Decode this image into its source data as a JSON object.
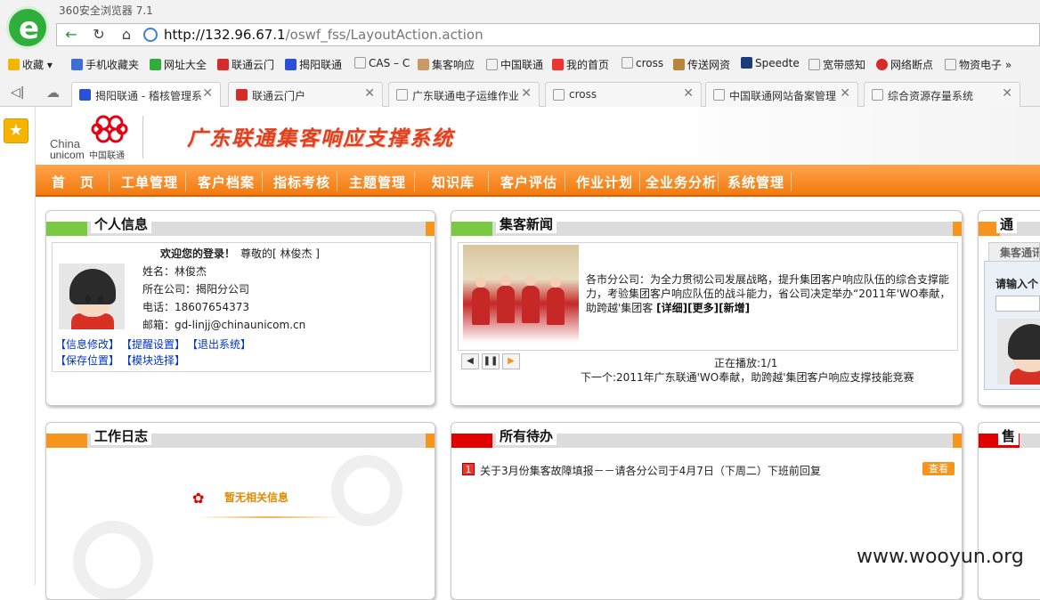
{
  "browser": {
    "window_title": "360安全浏览器 7.1",
    "url_host": "http://132.96.67.1",
    "url_path": "/oswf_fss/LayoutAction.action",
    "bookmarks": [
      "收藏",
      "手机收藏夹",
      "网址大全",
      "联通云门",
      "揭阳联通",
      "CAS – C",
      "集客响应",
      "中国联通",
      "我的首页",
      "cross",
      "传送网资",
      "Speedte",
      "宽带感知",
      "网络断点",
      "物资电子"
    ],
    "tabs": [
      "揭阳联通 - 稽核管理系",
      "联通云门户",
      "广东联通电子运维作业",
      "cross",
      "中国联通网站备案管理",
      "综合资源存量系统"
    ]
  },
  "header": {
    "logo_text": "China unicom中国联通",
    "system_title": "广东联通集客响应支撑系统"
  },
  "menu": [
    "首　页",
    "工单管理",
    "客户档案",
    "指标考核",
    "主题管理",
    "知识库",
    "客户评估",
    "作业计划",
    "全业务分析",
    "系统管理"
  ],
  "personal": {
    "title": "个人信息",
    "welcome": "欢迎您的登录！",
    "greeting": "尊敬的[ 林俊杰 ]",
    "name": "姓名：林俊杰",
    "company": "所在公司：揭阳分公司",
    "phone": "电话：18607654373",
    "email": "邮箱：gd-linjj@chinaunicom.cn",
    "links": [
      "【信息修改】",
      "【提醒设置】",
      "【退出系统】",
      "【保存位置】",
      "【模块选择】"
    ]
  },
  "news": {
    "title": "集客新闻",
    "body": "各市分公司：为全力贯彻公司发展战略，提升集团客户响应队伍的综合支撑能力，考验集团客户响应队伍的战斗能力，省公司决定举办“2011年'WO奉献，助跨越'集团客",
    "links": [
      "[详细]",
      "[更多]",
      "[新增]"
    ],
    "playing": "正在播放:1/1",
    "next": "下一个:2011年广东联通'WO奉献，助跨越'集团客户响应支撑技能竞赛"
  },
  "notice": {
    "title": "通",
    "tab": "集客通讯",
    "input_label": "请输入个"
  },
  "worklog": {
    "title": "工作日志",
    "empty": "暂无相关信息"
  },
  "todo": {
    "title": "所有待办",
    "items": [
      {
        "num": "1",
        "text": "关于3月份集客故障填报－－请各分公司于4月7日（下周二）下班前回复",
        "action": "查看"
      }
    ]
  },
  "warn": {
    "title": "售"
  },
  "watermark": "www.wooyun.org",
  "colors": {
    "orange": "#f7941d",
    "green": "#7ac943",
    "red": "#e10000",
    "title_red": "#e1401f",
    "link": "#0033cc"
  }
}
